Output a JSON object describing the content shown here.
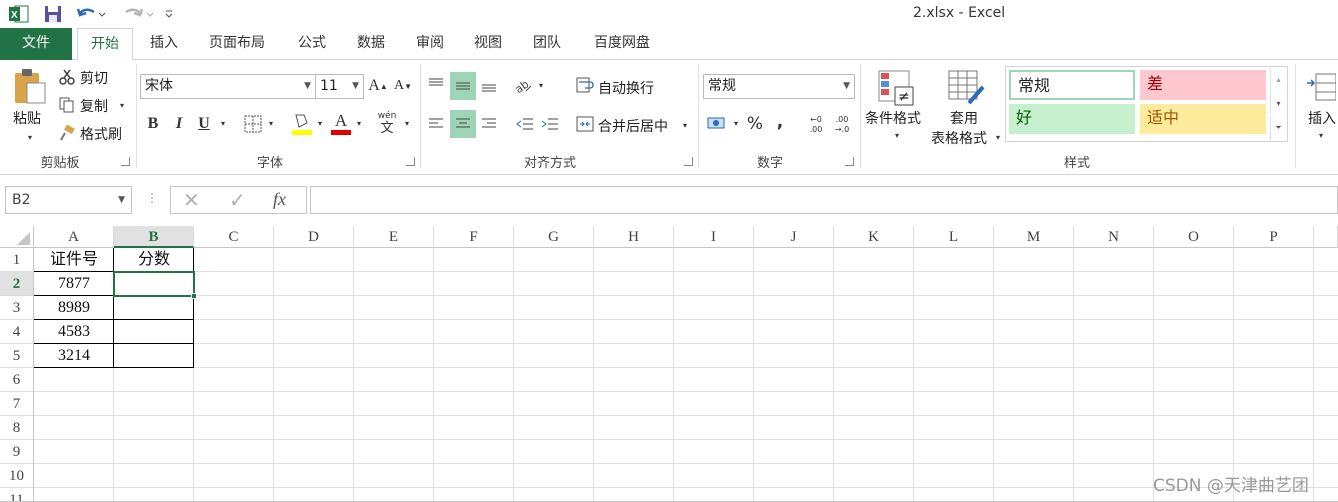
{
  "window": {
    "title": "2.xlsx - Excel"
  },
  "quick_access": {
    "save_icon": "save-icon",
    "undo_icon": "undo-icon",
    "redo_icon": "redo-icon"
  },
  "tabs": [
    {
      "label": "文件"
    },
    {
      "label": "开始"
    },
    {
      "label": "插入"
    },
    {
      "label": "页面布局"
    },
    {
      "label": "公式"
    },
    {
      "label": "数据"
    },
    {
      "label": "审阅"
    },
    {
      "label": "视图"
    },
    {
      "label": "团队"
    },
    {
      "label": "百度网盘"
    }
  ],
  "ribbon": {
    "clipboard": {
      "paste": "粘贴",
      "cut": "剪切",
      "copy": "复制",
      "format_painter": "格式刷",
      "group": "剪贴板"
    },
    "font": {
      "name": "宋体",
      "size": "11",
      "bold": "B",
      "italic": "I",
      "underline": "U",
      "font_color_glyph": "A",
      "phonetic_top": "wén",
      "phonetic_bottom": "文",
      "grow": "A",
      "shrink": "A",
      "group": "字体"
    },
    "alignment": {
      "wrap": "自动换行",
      "merge": "合并后居中",
      "group": "对齐方式"
    },
    "number": {
      "format": "常规",
      "percent": "%",
      "comma": ",",
      "inc_dec_top": "←0",
      "inc_dec_bottom": ".00",
      "dec_dec_top": ".00",
      "dec_dec_bottom": "→.0",
      "group": "数字"
    },
    "styles": {
      "conditional": "条件格式",
      "table_line1": "套用",
      "table_line2": "表格格式",
      "normal": "常规",
      "bad": "差",
      "good": "好",
      "neutral": "适中",
      "group": "样式"
    },
    "cells": {
      "insert": "插入"
    }
  },
  "colors": {
    "excel_green": "#217346",
    "bad_bg": "#ffc7ce",
    "bad_fg": "#9c0006",
    "good_bg": "#c6efce",
    "good_fg": "#006100",
    "neutral_bg": "#ffeb9c",
    "neutral_fg": "#9c5700"
  },
  "formula_bar": {
    "name_box": "B2",
    "cancel": "✕",
    "enter": "✓",
    "fx": "fx",
    "value": ""
  },
  "columns": [
    "A",
    "B",
    "C",
    "D",
    "E",
    "F",
    "G",
    "H",
    "I",
    "J",
    "K",
    "L",
    "M",
    "N",
    "O",
    "P"
  ],
  "rows": [
    "1",
    "2",
    "3",
    "4",
    "5",
    "6",
    "7",
    "8",
    "9",
    "10",
    "11"
  ],
  "cells": {
    "A1": "证件号",
    "B1": "分数",
    "A2": "7877",
    "A3": "8989",
    "A4": "4583",
    "A5": "3214"
  },
  "watermark": "CSDN @天津曲艺团"
}
